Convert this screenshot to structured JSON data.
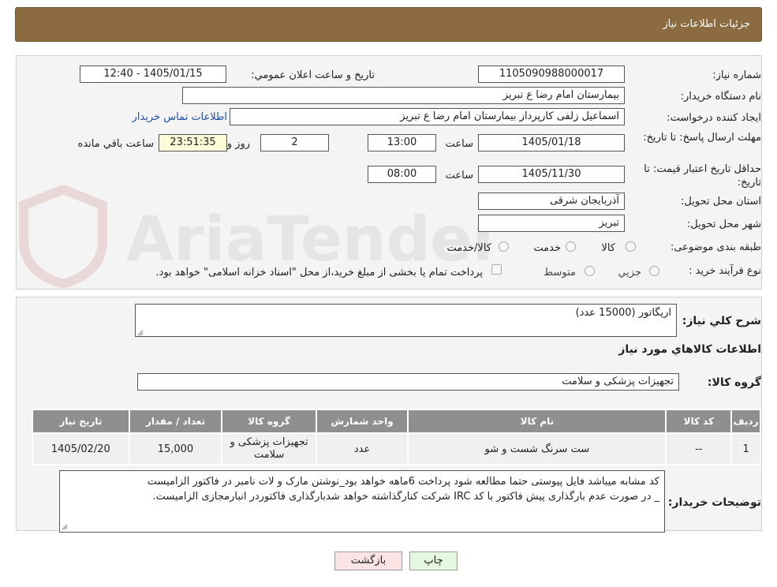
{
  "header": {
    "title": "جزئیات اطلاعات نیاز"
  },
  "watermark": {
    "text": "AriaTender.neT"
  },
  "fields": {
    "need_number_label": "شماره نیاز:",
    "need_number": "1105090988000017",
    "announce_label": "تاریخ و ساعت اعلان عمومي:",
    "announce_value": "1405/01/15 - 12:40",
    "buyer_org_label": "نام دستگاه خريدار:",
    "buyer_org": "بیمارستان امام رضا  ع  تبریز",
    "creator_label": "ايجاد كننده درخواست:",
    "creator": "اسماعیل زلفی کارپرداز بیمارستان امام رضا  ع  تبریز",
    "contact_link": "اطلاعات تماس خريدار",
    "deadline_label": "مهلت ارسال پاسخ: تا تاريخ:",
    "deadline_date": "1405/01/18",
    "time_label": "ساعت",
    "deadline_time": "13:00",
    "days_value": "2",
    "days_label": "روز و",
    "remaining_time": "23:51:35",
    "remaining_label": "ساعت باقي مانده",
    "validity_label": "حداقل تاريخ اعتبار قيمت: تا تاريخ:",
    "validity_date": "1405/11/30",
    "validity_time": "08:00",
    "province_label": "استان محل تحويل:",
    "province": "آذربایجان شرقی",
    "city_label": "شهر محل تحويل:",
    "city": "تبریز",
    "category_label": "طبقه بندی موضوعی:",
    "category_options": [
      "کالا",
      "خدمت",
      "کالا/خدمت"
    ],
    "process_label": "نوع فرآيند خريد :",
    "process_options": [
      "جزيي",
      "متوسط"
    ],
    "payment_note": "پرداخت تمام يا بخشی از مبلغ خريد،از محل \"اسناد خزانه اسلامی\" خواهد بود."
  },
  "summary": {
    "label": "شرح كلي نياز:",
    "value": "اريگاتور (15000 عدد)",
    "items_title": "اطلاعات كالاهاي مورد نياز",
    "group_label": "گروه كالا:",
    "group_value": "تجهیزات پزشکی و سلامت"
  },
  "table": {
    "headers": [
      "رديف",
      "كد كالا",
      "نام كالا",
      "واحد شمارش",
      "گروه كالا",
      "تعداد / مقدار",
      "تاريخ نياز"
    ],
    "rows": [
      [
        "1",
        "--",
        "ست سرنگ شست و شو",
        "عدد",
        "تجهیزات پزشکی و سلامت",
        "15,000",
        "1405/02/20"
      ]
    ]
  },
  "buyer_notes": {
    "label": "توضيحات خريدار:",
    "line1": "کد مشابه میباشد فایل پیوستی حتما مطالعه شود  پرداخت 6ماهه خواهد بود_نوشتن مارک و لات نامبر در فاکتور الزامیست",
    "line2": "_  در صورت عدم بارگذاری پیش فاکتور با کد IRC  شرکت کنارگذاشته خواهد شدبارگذاری فاکتوردر انبارمجازی الزامیست."
  },
  "buttons": {
    "print": "چاپ",
    "back": "بازگشت"
  },
  "colors": {
    "header": "#8b6b3f",
    "table_header": "#8f8f8f",
    "link": "#1f4ea8",
    "back_button": "#fde4e4",
    "print_button": "#e6f7e0"
  }
}
